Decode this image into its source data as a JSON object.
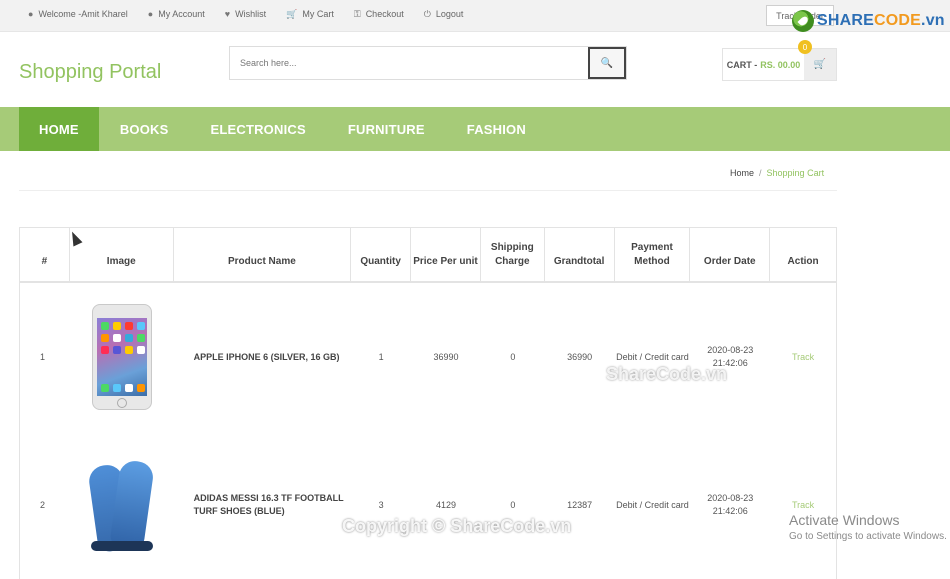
{
  "topbar": {
    "links": [
      {
        "icon": "user-icon",
        "label": "Welcome -Amit Kharel"
      },
      {
        "icon": "user-icon",
        "label": "My Account"
      },
      {
        "icon": "heart-icon",
        "label": "Wishlist"
      },
      {
        "icon": "cart-icon",
        "label": "My Cart"
      },
      {
        "icon": "key-icon",
        "label": "Checkout"
      },
      {
        "icon": "logout-icon",
        "label": "Logout"
      }
    ],
    "track_button": "Track Order"
  },
  "brand_watermark": {
    "main": "SHARE",
    "accent": "CODE",
    "suffix": ".vn"
  },
  "header": {
    "site_title": "Shopping Portal",
    "search_placeholder": "Search here...",
    "cart_label": "CART -",
    "cart_amount": "RS. 00.00",
    "cart_badge": "0"
  },
  "nav": {
    "items": [
      {
        "label": "HOME",
        "active": true
      },
      {
        "label": "BOOKS",
        "active": false
      },
      {
        "label": "ELECTRONICS",
        "active": false
      },
      {
        "label": "FURNITURE",
        "active": false
      },
      {
        "label": "FASHION",
        "active": false
      }
    ]
  },
  "breadcrumb": {
    "home": "Home",
    "separator": "/",
    "current": "Shopping Cart"
  },
  "table": {
    "headers": [
      "#",
      "Image",
      "Product Name",
      "Quantity",
      "Price Per unit",
      "Shipping Charge",
      "Grandtotal",
      "Payment Method",
      "Order Date",
      "Action"
    ],
    "rows": [
      {
        "index": "1",
        "image": "iphone-product-image",
        "name": "APPLE IPHONE 6 (SILVER, 16 GB)",
        "quantity": "1",
        "price": "36990",
        "shipping": "0",
        "grandtotal": "36990",
        "payment": "Debit / Credit card",
        "date": "2020-08-23 21:42:06",
        "action": "Track"
      },
      {
        "index": "2",
        "image": "shoes-product-image",
        "name": "ADIDAS MESSI 16.3 TF FOOTBALL TURF SHOES (BLUE)",
        "quantity": "3",
        "price": "4129",
        "shipping": "0",
        "grandtotal": "12387",
        "payment": "Debit / Credit card",
        "date": "2020-08-23 21:42:06",
        "action": "Track"
      }
    ]
  },
  "watermarks": {
    "center": "ShareCode.vn",
    "bottom": "Copyright © ShareCode.vn"
  },
  "activate_windows": {
    "title": "Activate Windows",
    "subtitle": "Go to Settings to activate Windows."
  },
  "colors": {
    "accent_green": "#a6cb78",
    "active_green": "#6fae3a",
    "title_green": "#92c360"
  }
}
